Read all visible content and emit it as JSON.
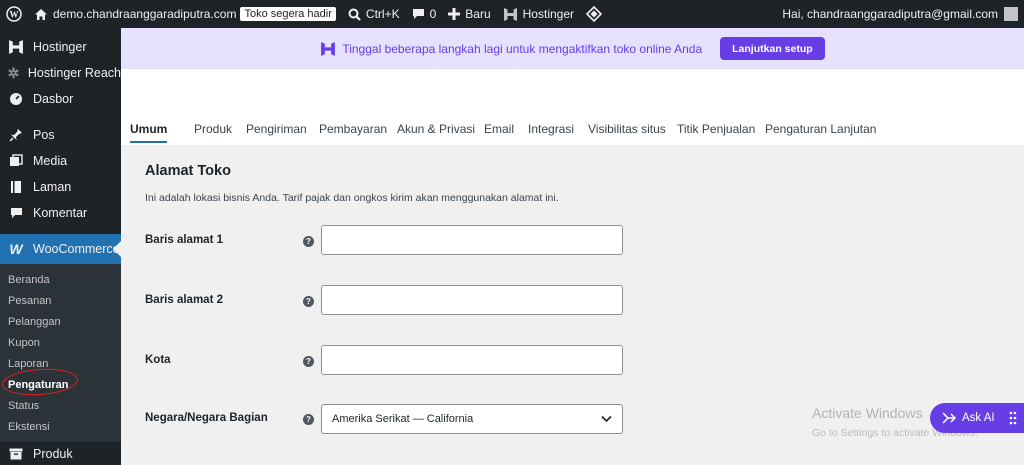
{
  "admin_bar": {
    "site": "demo.chandraanggaradiputra.com",
    "site_badge": "Toko segera hadir",
    "search_shortcut": "Ctrl+K",
    "comments_count": "0",
    "new_label": "Baru",
    "hostinger_label": "Hostinger",
    "greeting": "Hai, chandraanggaradiputra@gmail.com"
  },
  "sidebar": {
    "items": [
      {
        "label": "Hostinger",
        "icon": "hostinger-icon"
      },
      {
        "label": "Hostinger Reach",
        "icon": "reach-icon"
      },
      {
        "label": "Dasbor",
        "icon": "dashboard-icon"
      },
      {
        "label": "Pos",
        "icon": "pin-icon"
      },
      {
        "label": "Media",
        "icon": "media-icon"
      },
      {
        "label": "Laman",
        "icon": "page-icon"
      },
      {
        "label": "Komentar",
        "icon": "comment-icon"
      }
    ],
    "woocommerce": "WooCommerce",
    "submenu": [
      "Beranda",
      "Pesanan",
      "Pelanggan",
      "Kupon",
      "Laporan",
      "Pengaturan",
      "Status",
      "Ekstensi"
    ],
    "active_submenu": "Pengaturan",
    "produk": "Produk"
  },
  "banner": {
    "text": "Tinggal beberapa langkah lagi untuk mengaktifkan toko online Anda",
    "button": "Lanjutkan setup"
  },
  "tabs": [
    "Umum",
    "Produk",
    "Pengiriman",
    "Pembayaran",
    "Akun & Privasi",
    "Email",
    "Integrasi",
    "Visibilitas situs",
    "Titik Penjualan",
    "Pengaturan Lanjutan"
  ],
  "active_tab": "Umum",
  "section": {
    "title": "Alamat Toko",
    "description": "Ini adalah lokasi bisnis Anda. Tarif pajak dan ongkos kirim akan menggunakan alamat ini."
  },
  "fields": [
    {
      "label": "Baris alamat 1",
      "value": ""
    },
    {
      "label": "Baris alamat 2",
      "value": ""
    },
    {
      "label": "Kota",
      "value": ""
    }
  ],
  "country_field": {
    "label": "Negara/Negara Bagian",
    "selected": "Amerika Serikat — California"
  },
  "watermark": {
    "title": "Activate Windows",
    "subtitle": "Go to Settings to activate Windows."
  },
  "ask_ai": "Ask AI",
  "colors": {
    "accent": "#2271b1",
    "hostinger_purple": "#673de6",
    "admin_dark": "#1d2327"
  }
}
